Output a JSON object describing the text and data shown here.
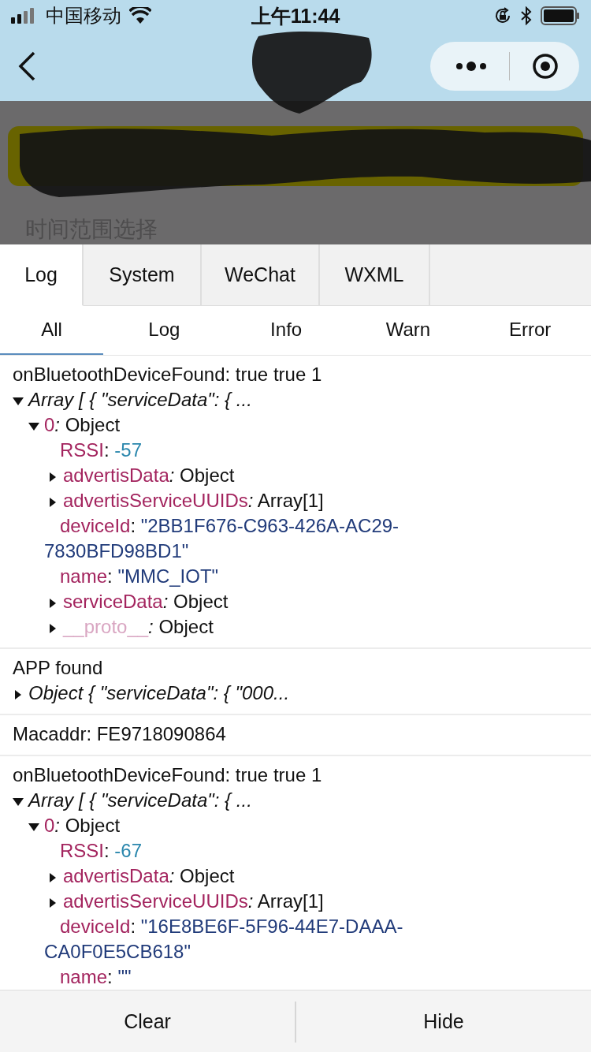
{
  "status_bar": {
    "carrier": "中国移动",
    "time": "上午11:44"
  },
  "page": {
    "section_label": "时间范围选择"
  },
  "console": {
    "tabs": [
      {
        "label": "Log",
        "selected": true
      },
      {
        "label": "System",
        "selected": false
      },
      {
        "label": "WeChat",
        "selected": false
      },
      {
        "label": "WXML",
        "selected": false
      }
    ],
    "filters": [
      {
        "label": "All",
        "selected": true
      },
      {
        "label": "Log",
        "selected": false
      },
      {
        "label": "Info",
        "selected": false
      },
      {
        "label": "Warn",
        "selected": false
      },
      {
        "label": "Error",
        "selected": false
      }
    ],
    "entries": [
      {
        "message": "onBluetoothDeviceFound: true true 1",
        "tree": {
          "summary": "Array [ { \"serviceData\": { ...",
          "expanded": true,
          "children": [
            {
              "key": "0",
              "sep": ":",
              "value": "Object",
              "kind": "object",
              "expanded": true,
              "children": [
                {
                  "key": "RSSI",
                  "sep": ":",
                  "value": "-57",
                  "kind": "number"
                },
                {
                  "key": "advertisData",
                  "sep": ":",
                  "value": "Object",
                  "kind": "object",
                  "expanded": false
                },
                {
                  "key": "advertisServiceUUIDs",
                  "sep": ":",
                  "value": "Array[1]",
                  "kind": "object",
                  "expanded": false
                },
                {
                  "key": "deviceId",
                  "sep": ":",
                  "value": "\"2BB1F676-C963-426A-AC29-7830BFD98BD1\"",
                  "kind": "string"
                },
                {
                  "key": "name",
                  "sep": ":",
                  "value": "\"MMC_IOT\"",
                  "kind": "string"
                },
                {
                  "key": "serviceData",
                  "sep": ":",
                  "value": "Object",
                  "kind": "object",
                  "expanded": false
                },
                {
                  "key": "__proto__",
                  "sep": ":",
                  "value": "Object",
                  "kind": "proto",
                  "expanded": false
                }
              ]
            }
          ]
        }
      },
      {
        "message": "APP found",
        "tree": {
          "summary": "Object { \"serviceData\": { \"000...",
          "expanded": false
        }
      },
      {
        "message": "Macaddr: FE9718090864"
      },
      {
        "message": "onBluetoothDeviceFound: true true 1",
        "tree": {
          "summary": "Array [ { \"serviceData\": { ...",
          "expanded": true,
          "children": [
            {
              "key": "0",
              "sep": ":",
              "value": "Object",
              "kind": "object",
              "expanded": true,
              "children": [
                {
                  "key": "RSSI",
                  "sep": ":",
                  "value": "-67",
                  "kind": "number"
                },
                {
                  "key": "advertisData",
                  "sep": ":",
                  "value": "Object",
                  "kind": "object",
                  "expanded": false
                },
                {
                  "key": "advertisServiceUUIDs",
                  "sep": ":",
                  "value": "Array[1]",
                  "kind": "object",
                  "expanded": false
                },
                {
                  "key": "deviceId",
                  "sep": ":",
                  "value": "\"16E8BE6F-5F96-44E7-DAAA-CA0F0E5CB618\"",
                  "kind": "string"
                },
                {
                  "key": "name",
                  "sep": ":",
                  "value": "\"\"",
                  "kind": "string"
                }
              ]
            }
          ]
        }
      }
    ],
    "buttons": [
      "Clear",
      "Hide"
    ]
  }
}
